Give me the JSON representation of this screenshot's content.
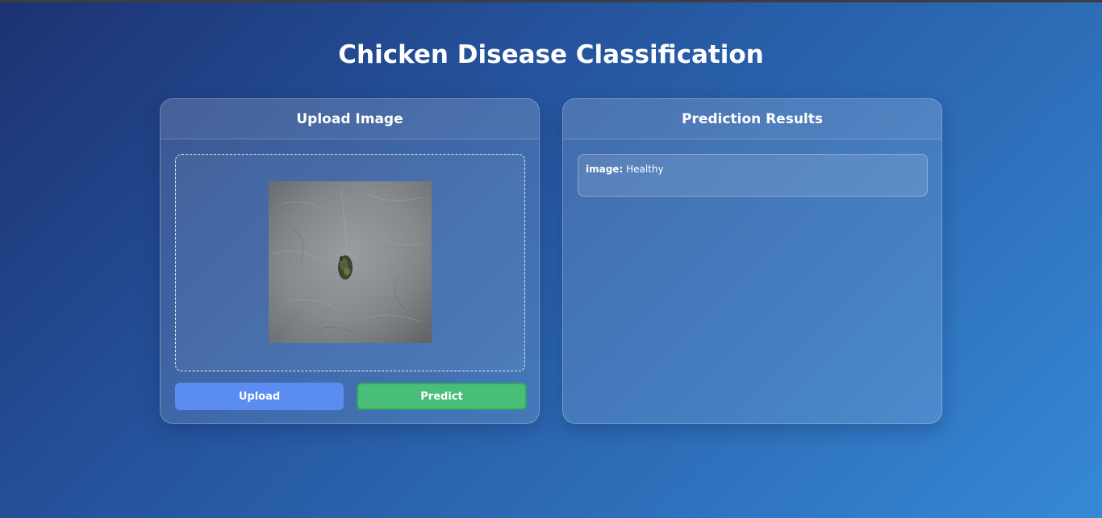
{
  "app": {
    "title": "Chicken Disease Classification"
  },
  "upload_panel": {
    "header": "Upload Image",
    "image_alt": "uploaded chicken fecal sample image",
    "upload_label": "Upload",
    "predict_label": "Predict"
  },
  "results_panel": {
    "header": "Prediction Results",
    "result": {
      "key": "image:",
      "value": "Healthy"
    }
  },
  "colors": {
    "upload_button": "#5b8cf0",
    "predict_button": "#48be78",
    "background_start": "#1c3272",
    "background_end": "#3689d6"
  }
}
